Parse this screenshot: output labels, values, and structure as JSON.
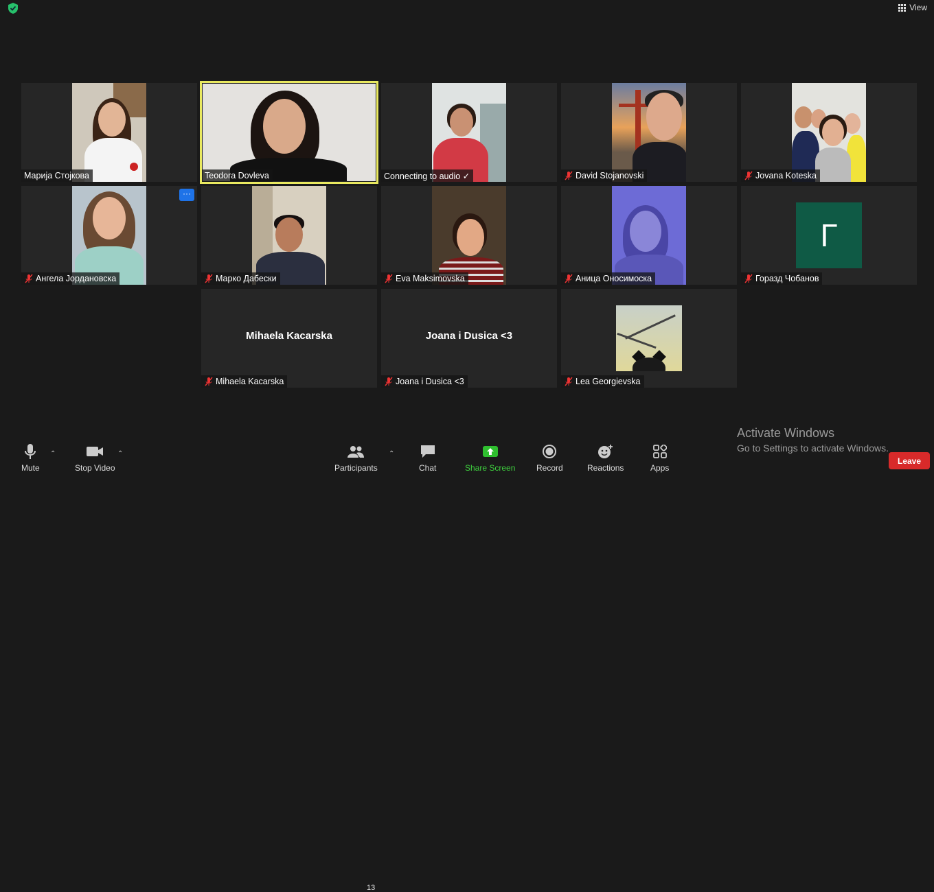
{
  "header": {
    "view_label": "View"
  },
  "tiles": [
    {
      "name": "Марија Стојкова"
    },
    {
      "name": "Teodora Dovleva"
    },
    {
      "name": "Connecting to audio ✓"
    },
    {
      "name": "David Stojanovski"
    },
    {
      "name": "Jovana Koteska"
    },
    {
      "name": "Ангела Јордановска",
      "more": "···"
    },
    {
      "name": "Марко Дабески"
    },
    {
      "name": "Eva Maksimovska"
    },
    {
      "name": "Аница Оносимоска"
    },
    {
      "name": "Горазд Чобанов",
      "avatar_letter": "Г"
    },
    {
      "name": "Mihaela Kacarska",
      "display_name": "Mihaela Kacarska"
    },
    {
      "name": "Joana i Dusica <3",
      "display_name": "Joana i Dusica <3"
    },
    {
      "name": "Lea Georgievska"
    }
  ],
  "toolbar": {
    "mute": "Mute",
    "stop_video": "Stop Video",
    "participants": "Participants",
    "participants_count": "13",
    "chat": "Chat",
    "share_screen": "Share Screen",
    "record": "Record",
    "reactions": "Reactions",
    "apps": "Apps",
    "leave": "Leave"
  },
  "watermark": {
    "line1": "Activate Windows",
    "line2": "Go to Settings to activate Windows."
  },
  "colors": {
    "active_speaker": "#e9e960",
    "share_green": "#3ecf3e",
    "leave_red": "#d82a2a",
    "avatar_green": "#0f5a45",
    "more_blue": "#1e73e8"
  }
}
